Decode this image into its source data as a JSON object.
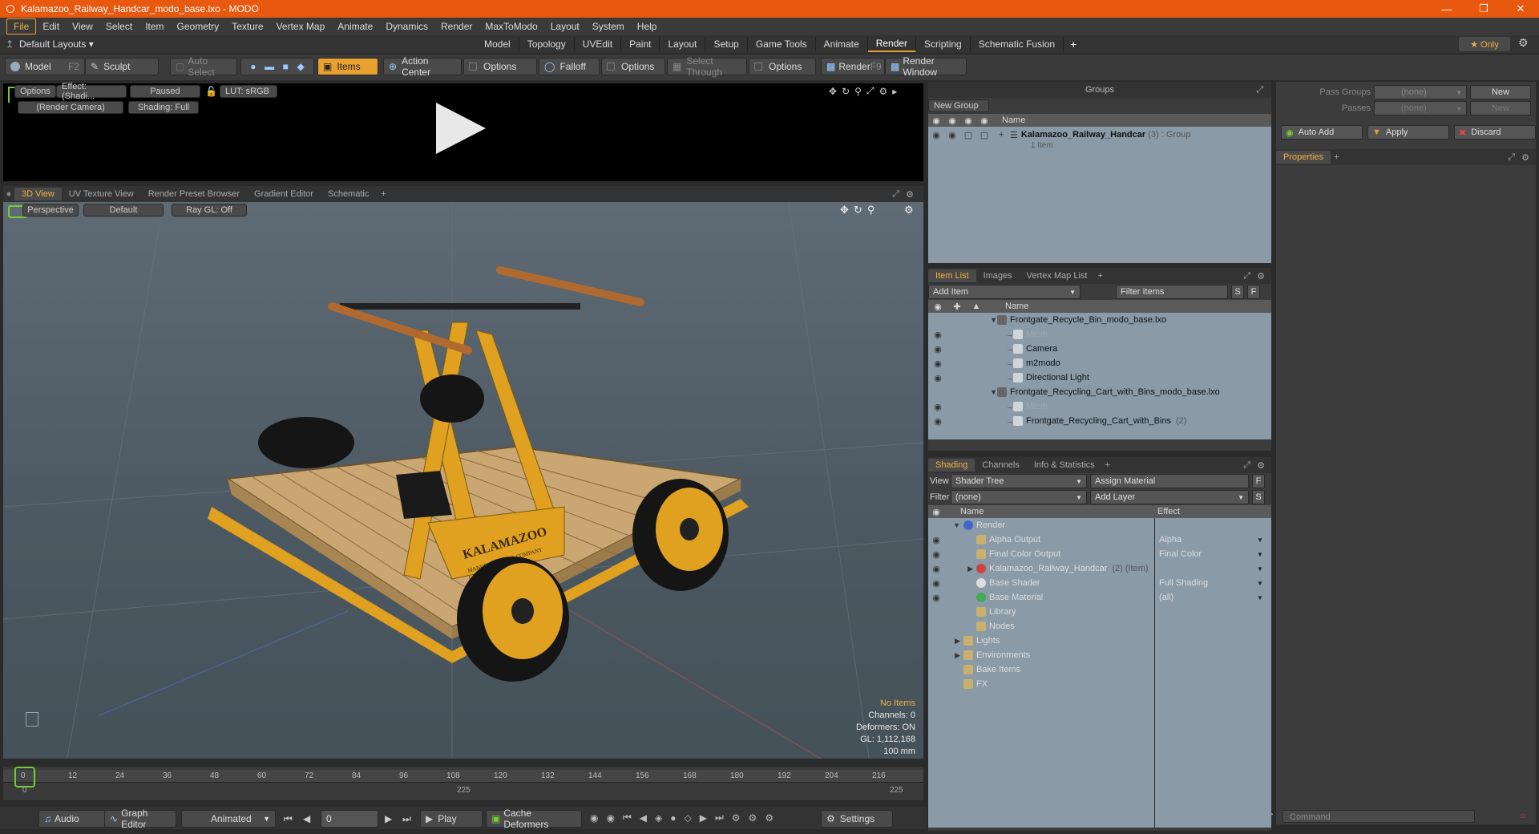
{
  "window": {
    "title": "Kalamazoo_Railway_Handcar_modo_base.lxo - MODO",
    "minimize": "—",
    "maximize": "❐",
    "close": "✕"
  },
  "menubar": [
    "File",
    "Edit",
    "View",
    "Select",
    "Item",
    "Geometry",
    "Texture",
    "Vertex Map",
    "Animate",
    "Dynamics",
    "Render",
    "MaxToModo",
    "Layout",
    "System",
    "Help"
  ],
  "layoutbar": {
    "default_layouts": "Default Layouts ▾",
    "tabs": [
      "Model",
      "Topology",
      "UVEdit",
      "Paint",
      "Layout",
      "Setup",
      "Game Tools",
      "Animate",
      "Render",
      "Scripting",
      "Schematic Fusion"
    ],
    "active_tab": "Render",
    "add": "+",
    "only": "★ Only"
  },
  "toolbar": {
    "model": "Model",
    "model_key": "F2",
    "sculpt": "Sculpt",
    "auto_select": "Auto Select",
    "items": "Items",
    "action_center": "Action Center",
    "options1": "Options",
    "falloff": "Falloff",
    "options2": "Options",
    "select_through": "Select Through",
    "options3": "Options",
    "render": "Render",
    "render_key": "F9",
    "render_window": "Render Window"
  },
  "render_preview": {
    "options": "Options",
    "effect": "Effect: (Shadi...",
    "paused": "Paused",
    "lut": "LUT: sRGB",
    "camera": "(Render Camera)",
    "shading": "Shading: Full"
  },
  "viewport_tabs": {
    "tabs": [
      "3D View",
      "UV Texture View",
      "Render Preset Browser",
      "Gradient Editor",
      "Schematic"
    ],
    "active": "3D View",
    "add": "+"
  },
  "viewport": {
    "perspective": "Perspective",
    "default": "Default",
    "raygl": "Ray GL: Off",
    "stats": {
      "no_items": "No Items",
      "channels": "Channels: 0",
      "deformers": "Deformers: ON",
      "gl": "GL: 1,112,168",
      "scale": "100 mm"
    },
    "brand": "KALAMAZOO",
    "brand_sub": "MANUFACTURING COMPANY"
  },
  "timeline": {
    "ticks": [
      "0",
      "12",
      "24",
      "36",
      "48",
      "60",
      "72",
      "84",
      "96",
      "108",
      "120",
      "132",
      "144",
      "156",
      "168",
      "180",
      "192",
      "204",
      "216"
    ],
    "start": "0",
    "mid": "225",
    "end": "225"
  },
  "transport": {
    "audio": "Audio",
    "graph_editor": "Graph Editor",
    "animated": "Animated",
    "frame": "0",
    "play": "Play",
    "cache_deformers": "Cache Deformers",
    "settings": "Settings"
  },
  "groups": {
    "title": "Groups",
    "new_group": "New Group",
    "col_name": "Name",
    "item_name": "Kalamazoo_Railway_Handcar",
    "item_count": "(3)",
    "item_type": ": Group",
    "item_sub": "1 Item"
  },
  "pass_groups": {
    "pass_groups_label": "Pass Groups",
    "pass_groups_value": "(none)",
    "passes_label": "Passes",
    "passes_value": "(none)",
    "new1": "New",
    "new2": "New",
    "auto_add": "Auto Add",
    "apply": "Apply",
    "discard": "Discard",
    "properties": "Properties",
    "add": "+"
  },
  "item_list": {
    "tabs": [
      "Item List",
      "Images",
      "Vertex Map List"
    ],
    "active": "Item List",
    "add": "+",
    "add_item": "Add Item",
    "filter_items": "Filter Items",
    "s": "S",
    "f": "F",
    "col_name": "Name",
    "rows": [
      {
        "label": "Frontgate_Recycle_Bin_modo_base.lxo",
        "indent": 0,
        "dim": false
      },
      {
        "label": "Mesh",
        "indent": 1,
        "dim": true
      },
      {
        "label": "Camera",
        "indent": 1,
        "dim": false
      },
      {
        "label": "m2modo",
        "indent": 1,
        "dim": false
      },
      {
        "label": "Directional Light",
        "indent": 1,
        "dim": false
      },
      {
        "label": "Frontgate_Recycling_Cart_with_Bins_modo_base.lxo",
        "indent": 0,
        "dim": false
      },
      {
        "label": "Mesh",
        "indent": 1,
        "dim": true
      },
      {
        "label": "Frontgate_Recycling_Cart_with_Bins",
        "indent": 1,
        "dim": false,
        "suffix": "(2)"
      }
    ]
  },
  "shading": {
    "tabs": [
      "Shading",
      "Channels",
      "Info & Statistics"
    ],
    "active": "Shading",
    "add": "+",
    "view_label": "View",
    "view_value": "Shader Tree",
    "assign_material": "Assign Material",
    "filter_label": "Filter",
    "filter_value": "(none)",
    "add_layer": "Add Layer",
    "f": "F",
    "s": "S",
    "col_name": "Name",
    "col_effect": "Effect",
    "rows": [
      {
        "label": "Render",
        "effect": "",
        "indent": 0
      },
      {
        "label": "Alpha Output",
        "effect": "Alpha",
        "indent": 1
      },
      {
        "label": "Final Color Output",
        "effect": "Final Color",
        "indent": 1
      },
      {
        "label": "Kalamazoo_Railway_Handcar",
        "suffix": "(2) (Item)",
        "effect": "",
        "indent": 1
      },
      {
        "label": "Base Shader",
        "effect": "Full Shading",
        "indent": 1
      },
      {
        "label": "Base Material",
        "effect": "(all)",
        "indent": 1
      },
      {
        "label": "Library",
        "effect": "",
        "indent": 1
      },
      {
        "label": "Nodes",
        "effect": "",
        "indent": 1
      },
      {
        "label": "Lights",
        "effect": "",
        "indent": 0
      },
      {
        "label": "Environments",
        "effect": "",
        "indent": 0
      },
      {
        "label": "Bake Items",
        "effect": "",
        "indent": 0
      },
      {
        "label": "FX",
        "effect": "",
        "indent": 0
      }
    ]
  },
  "command": {
    "placeholder": "Command"
  },
  "colors": {
    "accent": "#e8a030",
    "titlebar": "#e8580f",
    "wheel": "#e0a020",
    "deck": "#c9a672"
  }
}
